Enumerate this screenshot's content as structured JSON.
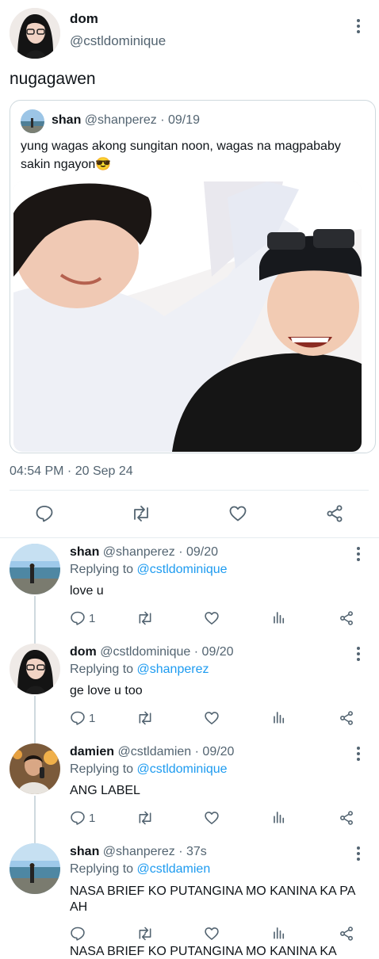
{
  "tweet": {
    "display_name": "dom",
    "handle": "@cstldominique",
    "text": "nugagawen",
    "timestamp": "04:54 PM · 20 Sep 24"
  },
  "quote": {
    "display_name": "shan",
    "handle": "@shanperez",
    "date": "· 09/19",
    "text": "yung wagas akong sungitan noon, wagas na magpababy sakin ngayon😎"
  },
  "replies": [
    {
      "display_name": "shan",
      "handle": "@shanperez",
      "date": "· 09/20",
      "replying_prefix": "Replying to",
      "replying_to": "@cstldominique",
      "text": "love u",
      "reply_count": "1"
    },
    {
      "display_name": "dom",
      "handle": "@cstldominique",
      "date": "· 09/20",
      "replying_prefix": "Replying to",
      "replying_to": "@shanperez",
      "text": "ge love u too",
      "reply_count": "1"
    },
    {
      "display_name": "damien",
      "handle": "@cstldamien",
      "date": "· 09/20",
      "replying_prefix": "Replying to",
      "replying_to": "@cstldominique",
      "text": "ANG LABEL",
      "reply_count": "1"
    },
    {
      "display_name": "shan",
      "handle": "@shanperez",
      "date": "· 37s",
      "replying_prefix": "Replying to",
      "replying_to": "@cstldamien",
      "text": "NASA BRIEF KO PUTANGINA MO KANINA KA PA AH",
      "reply_count": ""
    }
  ],
  "cutoff_text": "NASA BRIEF KO PUTANGINA MO KANINA KA",
  "colors": {
    "link": "#1d9bf0",
    "secondary_text": "#536471",
    "border": "#cfd9de"
  },
  "icons": [
    "more-icon",
    "reply-icon",
    "retweet-icon",
    "like-icon",
    "share-icon",
    "views-icon"
  ]
}
